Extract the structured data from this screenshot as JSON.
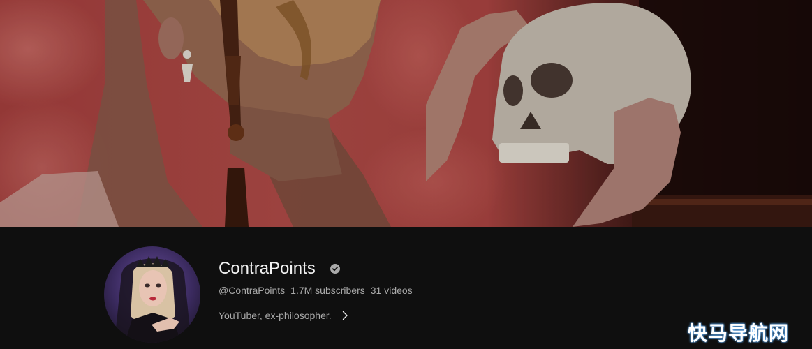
{
  "channel": {
    "name": "ContraPoints",
    "handle": "@ContraPoints",
    "subscribers": "1.7M subscribers",
    "videos": "31 videos",
    "description": "YouTuber, ex-philosopher."
  },
  "icons": {
    "verified": "verified-check-icon",
    "more": "chevron-right-icon"
  },
  "watermark": "快马导航网",
  "colors": {
    "background": "#0f0f0f",
    "primary_text": "#f1f1f1",
    "secondary_text": "#aaaaaa"
  }
}
